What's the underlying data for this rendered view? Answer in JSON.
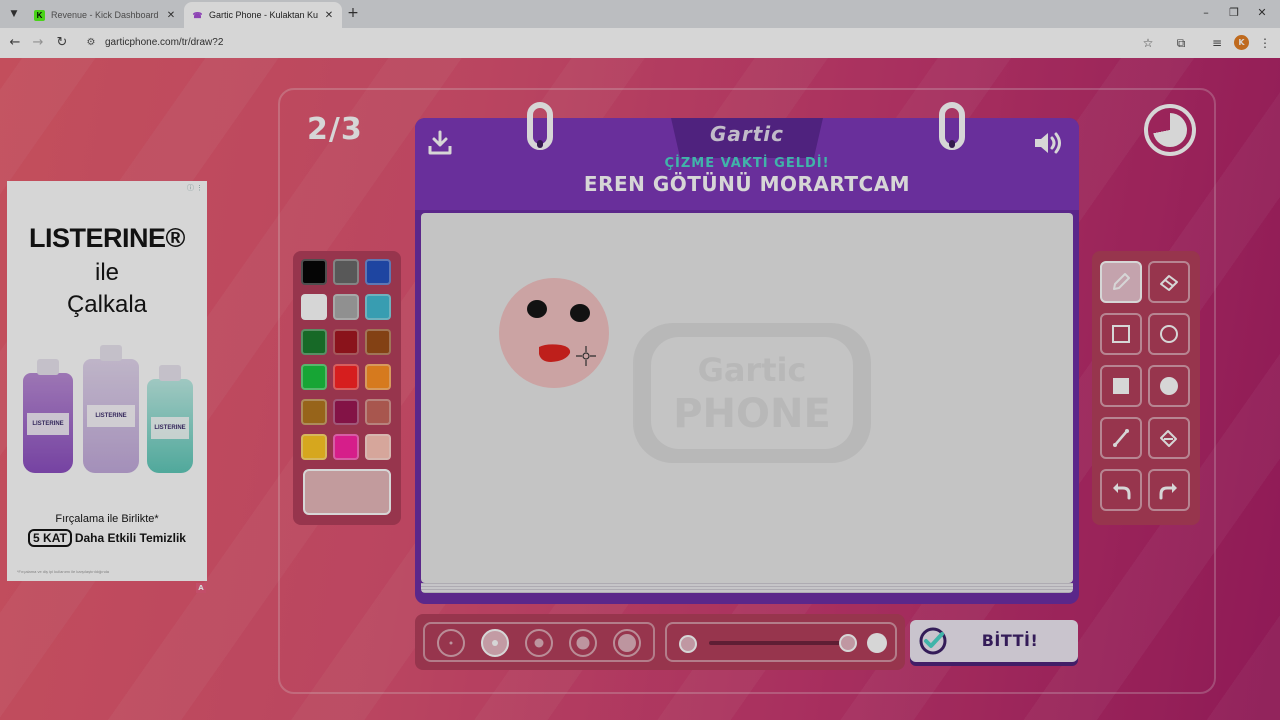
{
  "browser": {
    "tabs": [
      {
        "title": "Revenue - Kick Dashboard",
        "favicon": "K",
        "favicon_color": "#53fc18",
        "active": false
      },
      {
        "title": "Gartic Phone - Kulaktan Kulağa",
        "favicon": "☎",
        "favicon_color": "#a64bd6",
        "active": true
      }
    ],
    "url": "garticphone.com/tr/draw?2",
    "profile_initial": "K",
    "icons": {
      "tab_search": "chevron-down-icon",
      "new_tab": "plus-icon",
      "back": "arrow-left-icon",
      "forward": "arrow-right-icon",
      "reload": "reload-icon",
      "site_info": "tune-icon",
      "bookmark": "star-icon",
      "extensions": "puzzle-icon",
      "media": "media-icon",
      "menu": "kebab-icon",
      "minimize": "minimize-icon",
      "restore": "restore-icon",
      "close": "close-icon"
    }
  },
  "game": {
    "round": "2/3",
    "logo": "Gartic",
    "prompt_label": "ÇİZME VAKTİ GELDİ!",
    "prompt_word": "EREN GÖTÜNÜ MORARTCAM",
    "done_label": "BİTTİ!",
    "timer_progress": 0.72,
    "palette": [
      "#000000",
      "#666666",
      "#1f4fbf",
      "#ffffff",
      "#aaaaaa",
      "#3fbad2",
      "#167a2a",
      "#a3121b",
      "#9a4a13",
      "#16c43b",
      "#ff1f1f",
      "#ff8f1f",
      "#b2741a",
      "#9a1250",
      "#c7635a",
      "#ffc61f",
      "#ff1fa3",
      "#ffc5b8"
    ],
    "current_color": "#e7b7ba",
    "brush_sizes": [
      1,
      2,
      3,
      4,
      5
    ],
    "selected_brush_size": 2,
    "opacity": 0.9,
    "selected_tool": "pencil",
    "tools": [
      "pencil",
      "eraser",
      "rectangle-outline",
      "ellipse-outline",
      "rectangle-filled",
      "ellipse-filled",
      "line",
      "fill-bucket",
      "undo",
      "redo"
    ],
    "colors": {
      "accent": "#7b34b8",
      "panel": "#b33b58",
      "prompt_label": "#48d6c8"
    }
  },
  "ad": {
    "brand": "LISTERINE®",
    "line2": "ile",
    "line3": "Çalkala",
    "bottle_labels": [
      "LISTERINE",
      "LISTERINE",
      "LISTERINE"
    ],
    "tagline1": "Fırçalama ile Birlikte*",
    "tagline_kat": "5 KAT",
    "tagline2": "Daha Etkili Temizlik",
    "fine_print": "*Fırçalama ve diş ipi kullanımı ile karşılaştırıldığında",
    "info": "ⓘ ⋮",
    "corner": "A"
  }
}
